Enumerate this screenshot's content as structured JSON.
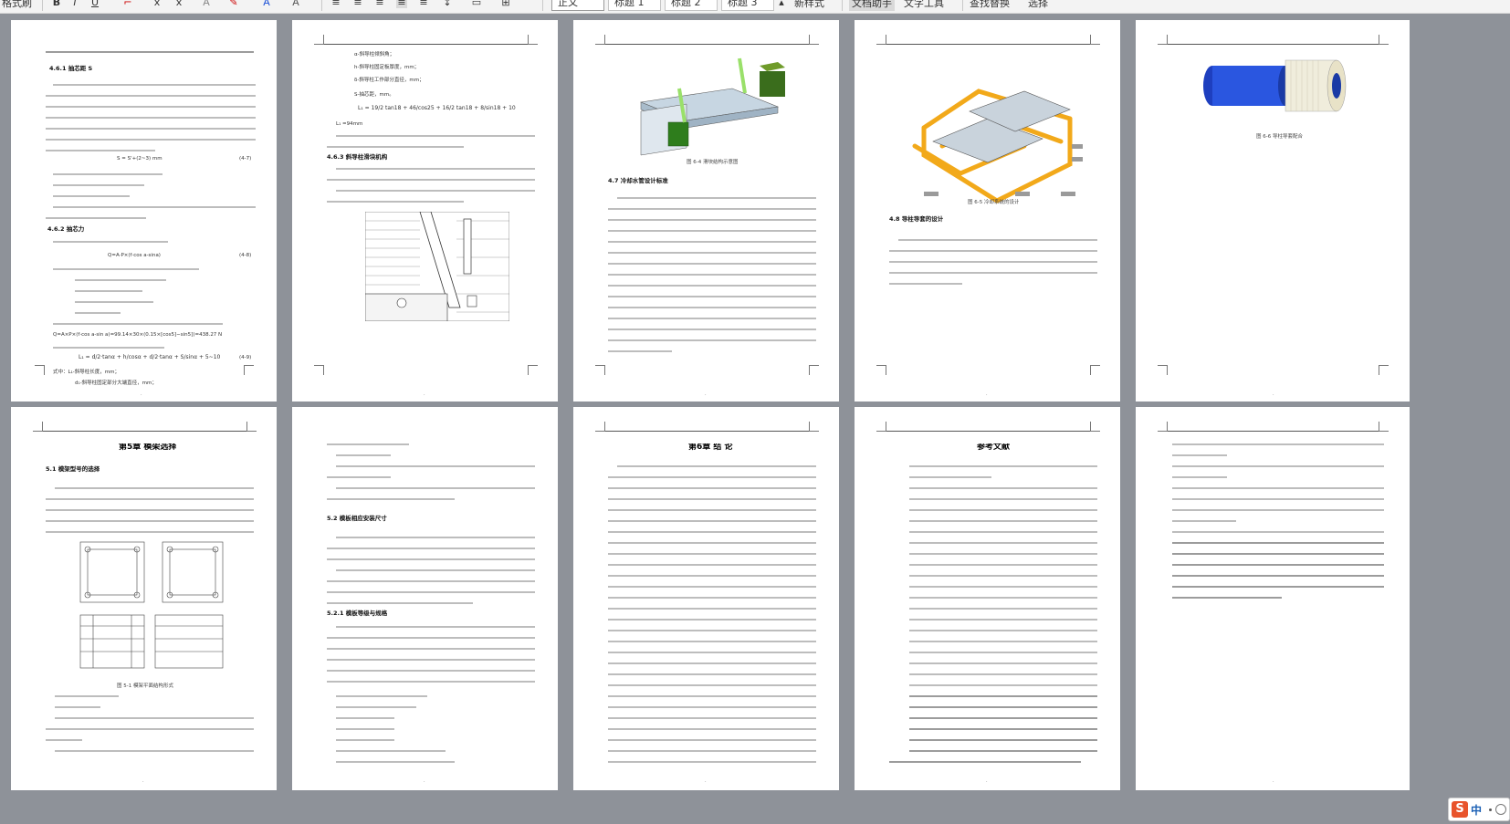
{
  "toolbar": {
    "format_brush": "格式刷",
    "bold": "B",
    "italic": "I",
    "underline": "U",
    "styles": [
      "正文",
      "标题 1",
      "标题 2",
      "标题 3"
    ],
    "new_style": "新样式",
    "text_assistant": "文档助手",
    "text_tools": "文字工具",
    "find_replace": "查找替换",
    "select": "选择"
  },
  "pages": {
    "p1": {
      "h_461": "4.6.1 抽芯距 S",
      "h_462": "4.6.2 抽芯力",
      "formula_s": "S = S'+(2~3) mm",
      "eq1": "(4-7)",
      "formula_q": "Q=A·P×(f·cos a-sina)",
      "eq2": "(4-8)",
      "q_result": "Q=A×P×(f·cos a-sin a)=99.14×30×(0.15×[cos5]−sin5])=438.27 N",
      "eq3": "(4-9)",
      "where": "式中：L₁-斜导柱长度，mm；",
      "where2": "d₁-斜导柱固定部分大端直径，mm；"
    },
    "p2": {
      "l1": "α-斜导柱倾斜角；",
      "l2": "h-斜导柱固定板厚度，mm；",
      "l3": "δ-斜导柱工作部分直径，mm；",
      "l4": "S-抽芯距，mm。",
      "formula": "L₁ = 19/2 tan18 + 46/cos25 + 16/2 tan18 + 8/sin18 + 10",
      "l_result": "L₁ =94mm",
      "h_463": "4.6.3 斜导柱滑块机构"
    },
    "p3": {
      "caption_64": "图 6-4 滑块结构示意图",
      "h_47": "4.7 冷却水管设计标准"
    },
    "p4": {
      "caption_65": "图 6-5 冷却系统的设计",
      "h_48": "4.8 导柱导套的设计"
    },
    "p5": {
      "caption_66": "图 6-6 导柱导套配合"
    },
    "p6": {
      "chapter": "第5章  模架选择",
      "h_51": "5.1 模架型号的选择",
      "caption_51": "图 5-1  模架平面结构形式"
    },
    "p7": {
      "h_52": "5.2 模板相应安装尺寸",
      "h_521": "5.2.1 模板等级与规格"
    },
    "p8": {
      "chapter": "第6章 结 论"
    },
    "p9": {
      "chapter": "参考文献"
    }
  },
  "ime": {
    "logo": "S",
    "lang": "中"
  }
}
